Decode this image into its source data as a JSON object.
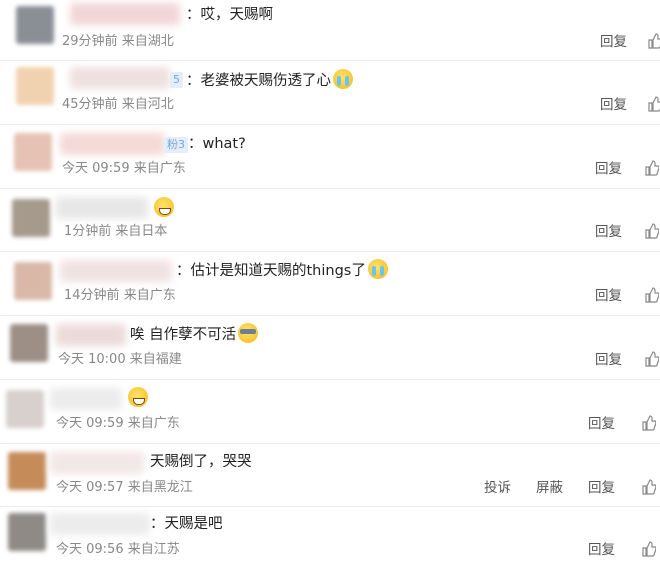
{
  "actions": {
    "reply": "回复",
    "report": "投诉",
    "block": "屏蔽"
  },
  "comments": [
    {
      "text": "：哎，天赐啊",
      "emoji": "",
      "time": "29分钟前",
      "location": "来自湖北"
    },
    {
      "text": "：老婆被天赐伤透了心",
      "emoji": "cry",
      "time": "45分钟前",
      "location": "来自河北",
      "badge": "5"
    },
    {
      "text": "：what?",
      "emoji": "",
      "time": "今天 09:59",
      "location": "来自广东",
      "badge": "粉3"
    },
    {
      "text": "",
      "emoji": "grin",
      "time": "1分钟前",
      "location": "来自日本"
    },
    {
      "text": "：估计是知道天赐的things了",
      "emoji": "cry",
      "time": "14分钟前",
      "location": "来自广东"
    },
    {
      "text": "唉 自作孽不可活",
      "emoji": "cool",
      "time": "今天 10:00",
      "location": "来自福建"
    },
    {
      "text": "",
      "emoji": "grin",
      "time": "今天 09:59",
      "location": "来自广东"
    },
    {
      "text": "天赐倒了，哭哭",
      "emoji": "",
      "time": "今天 09:57",
      "location": "来自黑龙江"
    },
    {
      "text": "：天赐是吧",
      "emoji": "",
      "time": "今天 09:56",
      "location": "来自江苏"
    }
  ]
}
